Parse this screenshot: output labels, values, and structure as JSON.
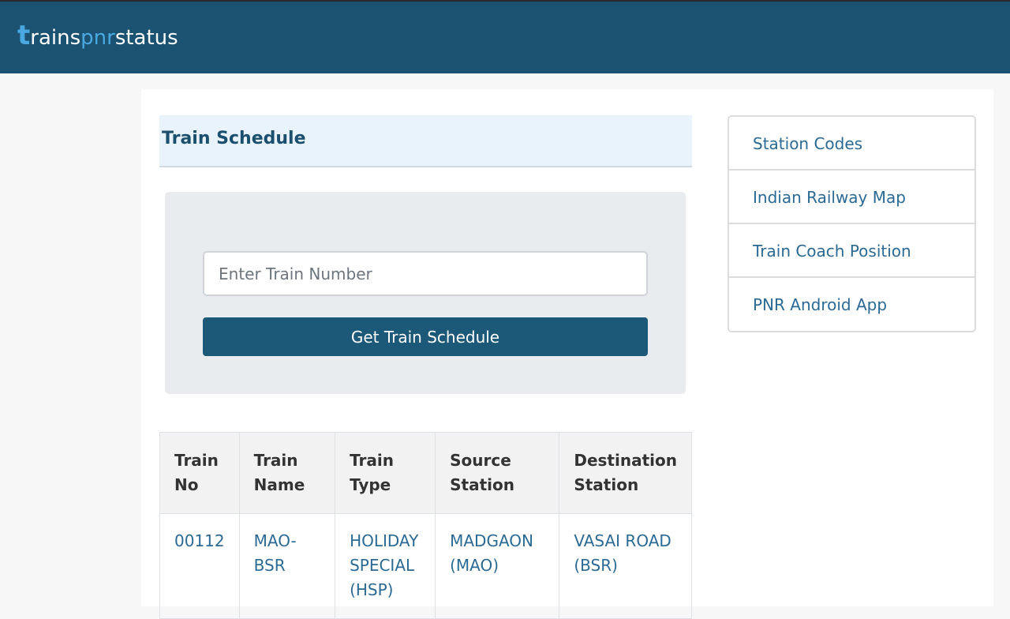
{
  "header": {
    "logo": {
      "t": "t",
      "part1": "rains",
      "part2": "pnr",
      "part3": "status"
    }
  },
  "schedule_section": {
    "title": "Train Schedule",
    "input_placeholder": "Enter Train Number",
    "input_value": "",
    "button_label": "Get Train Schedule"
  },
  "table": {
    "headers": [
      "Train No",
      "Train Name",
      "Train Type",
      "Source Station",
      "Destination Station"
    ],
    "rows": [
      {
        "train_no": "00112",
        "train_name": "MAO-BSR",
        "train_type": "HOLIDAY SPECIAL (HSP)",
        "source": "MADGAON (MAO)",
        "destination": "VASAI ROAD (BSR)"
      }
    ]
  },
  "sidebar": {
    "items": [
      {
        "label": "Station Codes"
      },
      {
        "label": "Indian Railway Map"
      },
      {
        "label": "Train Coach Position"
      },
      {
        "label": "PNR Android App"
      }
    ]
  },
  "colors": {
    "header_bg": "#1c5271",
    "accent": "#4aa8e0",
    "button_bg": "#1c5878",
    "link": "#2b6a94"
  }
}
